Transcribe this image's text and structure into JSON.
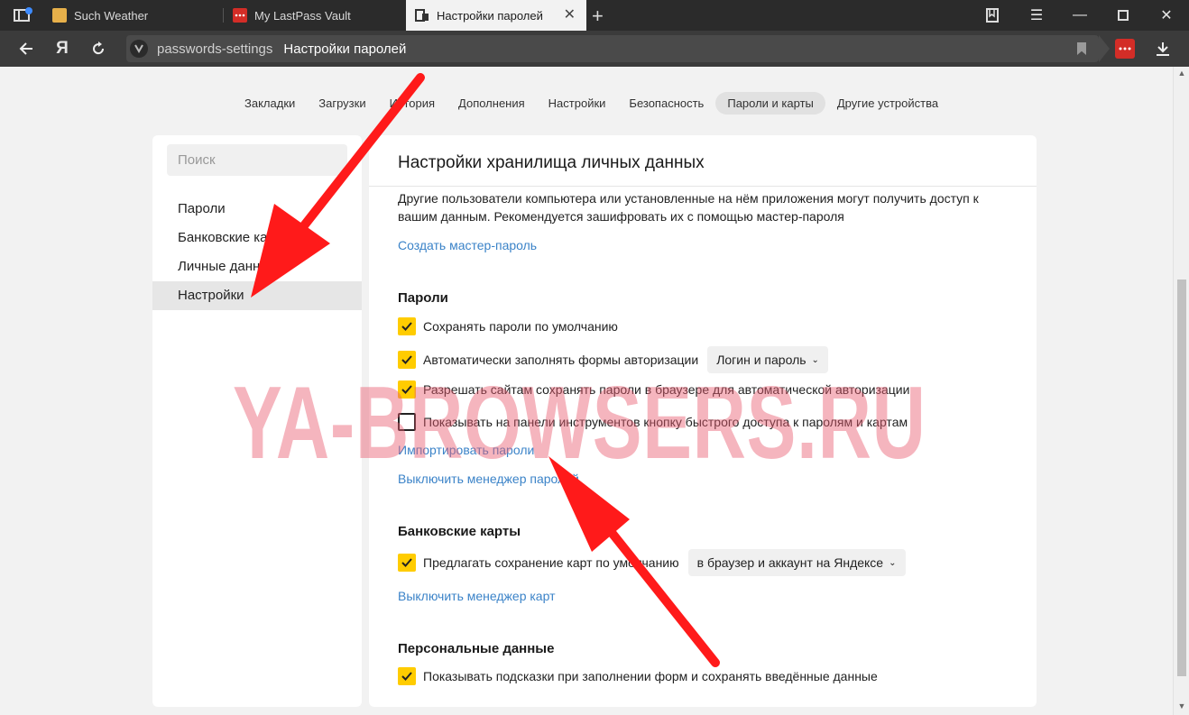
{
  "browser": {
    "tabs": [
      {
        "title": "Such Weather",
        "icon": "weather-cat-icon"
      },
      {
        "title": "My LastPass Vault",
        "icon": "lastpass-icon"
      },
      {
        "title": "Настройки паролей",
        "icon": "passwords-icon",
        "active": true
      }
    ],
    "address": {
      "url": "passwords-settings",
      "title": "Настройки паролей"
    },
    "yandex_logo": "Я"
  },
  "topnav": [
    "Закладки",
    "Загрузки",
    "История",
    "Дополнения",
    "Настройки",
    "Безопасность",
    "Пароли и карты",
    "Другие устройства"
  ],
  "topnav_active": "Пароли и карты",
  "sidebar": {
    "search_placeholder": "Поиск",
    "items": [
      "Пароли",
      "Банковские карты",
      "Личные данные",
      "Настройки"
    ],
    "selected": "Настройки"
  },
  "main": {
    "header": "Настройки хранилища личных данных",
    "description": "Другие пользователи компьютера или установленные на нём приложения могут получить доступ к вашим данным. Рекомендуется зашифровать их с помощью мастер-пароля",
    "create_master_link": "Создать мастер-пароль",
    "passwords": {
      "title": "Пароли",
      "opt_save": "Сохранять пароли по умолчанию",
      "opt_autofill": "Автоматически заполнять формы авторизации",
      "autofill_select": "Логин и пароль",
      "opt_allow_sites": "Разрешать сайтам сохранять пароли в браузере для автоматической авторизации",
      "opt_toolbar_button": "Показывать на панели инструментов кнопку быстрого доступа к паролям и картам",
      "import_link": "Импортировать пароли",
      "disable_link": "Выключить менеджер паролей"
    },
    "cards": {
      "title": "Банковские карты",
      "opt_offer_save": "Предлагать сохранение карт по умолчанию",
      "save_select": "в браузер и аккаунт на Яндексе",
      "disable_link": "Выключить менеджер карт"
    },
    "personal": {
      "title": "Персональные данные",
      "opt_hints": "Показывать подсказки при заполнении форм и сохранять введённые данные"
    }
  },
  "watermark": "YA-BROWSERS.RU",
  "colors": {
    "accent": "#ffcc00",
    "link": "#3b83c8",
    "arrow": "#ff1a1a"
  }
}
